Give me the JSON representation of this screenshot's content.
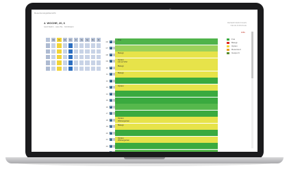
{
  "app": {
    "title": "Reservierungsübersicht"
  },
  "header": {
    "title": "4. WOCHE, 20, 6",
    "subtitle": "GESTERN · HEUTE · MORGEN",
    "right_line1": "RESERVIERUNGEN",
    "right_line2": "NEUE ANFRAGE",
    "link": "Hilfe"
  },
  "legend": [
    {
      "label": "Frei",
      "color": "#3aaa3f"
    },
    {
      "label": "Belegt",
      "color": "#e0291f"
    },
    {
      "label": "Option",
      "color": "#f1d43a"
    },
    {
      "label": "Reserviert",
      "color": "#eba020"
    },
    {
      "label": "Gesperrt",
      "color": "#5a8f2f"
    }
  ],
  "calendar": {
    "columns": [
      "",
      "Mo",
      "Di",
      "Mi",
      "Do",
      "Fr",
      "Sa",
      "So",
      "Mo",
      "Di"
    ],
    "rows": [
      [
        "",
        "",
        "",
        "",
        "",
        "",
        "",
        "",
        "",
        ""
      ],
      [
        "",
        "",
        "",
        "",
        "",
        "",
        "",
        "",
        "",
        ""
      ],
      [
        "",
        "",
        "",
        "",
        "",
        "",
        "",
        "",
        "",
        ""
      ],
      [
        "",
        "",
        "",
        "",
        "",
        "",
        "",
        "",
        "",
        ""
      ],
      [
        "",
        "",
        "",
        "",
        "",
        "",
        "",
        "",
        "",
        ""
      ]
    ]
  },
  "rows": [
    {
      "label": "06",
      "num": "1",
      "text": "Frei",
      "color": "#4fb34a"
    },
    {
      "label": "07",
      "num": "2",
      "text": "",
      "color": "#9bd15a"
    },
    {
      "label": "08",
      "num": "3",
      "text": "Belegt",
      "color": "#e7e34a"
    },
    {
      "label": "09",
      "num": "4",
      "text": "Option\n13:12 ST2",
      "color": "#e7e34a"
    },
    {
      "label": "10",
      "num": "5",
      "text": "Belegt",
      "color": "#e7e34a"
    },
    {
      "label": "11",
      "num": "6",
      "text": "Belegt",
      "color": "#e7e34a"
    },
    {
      "label": "12",
      "num": "7",
      "text": "",
      "color": "#3aaa3f"
    },
    {
      "label": "13",
      "num": "8",
      "text": "Option",
      "color": "#e7e34a"
    },
    {
      "label": "14",
      "num": "9",
      "text": "",
      "color": "#3aaa3f"
    },
    {
      "label": "15",
      "num": "10",
      "text": "",
      "color": "#3aaa3f"
    },
    {
      "label": "16",
      "num": "11",
      "text": "",
      "color": "#56b84c"
    },
    {
      "label": "17",
      "num": "12",
      "text": "",
      "color": "#3aaa3f"
    },
    {
      "label": "18",
      "num": "13",
      "text": "Option\nWintergarten",
      "color": "#e7e34a"
    },
    {
      "label": "19",
      "num": "14",
      "text": "Belegt",
      "color": "#e7e34a"
    },
    {
      "label": "20",
      "num": "15",
      "text": "",
      "color": "#3aaa3f"
    },
    {
      "label": "21",
      "num": "16",
      "text": "Option\nWintergarten",
      "color": "#e7e34a"
    },
    {
      "label": "22",
      "num": "17",
      "text": "",
      "color": "#3aaa3f"
    },
    {
      "label": "23",
      "num": "18",
      "text": "",
      "color": "#56b84c"
    }
  ]
}
